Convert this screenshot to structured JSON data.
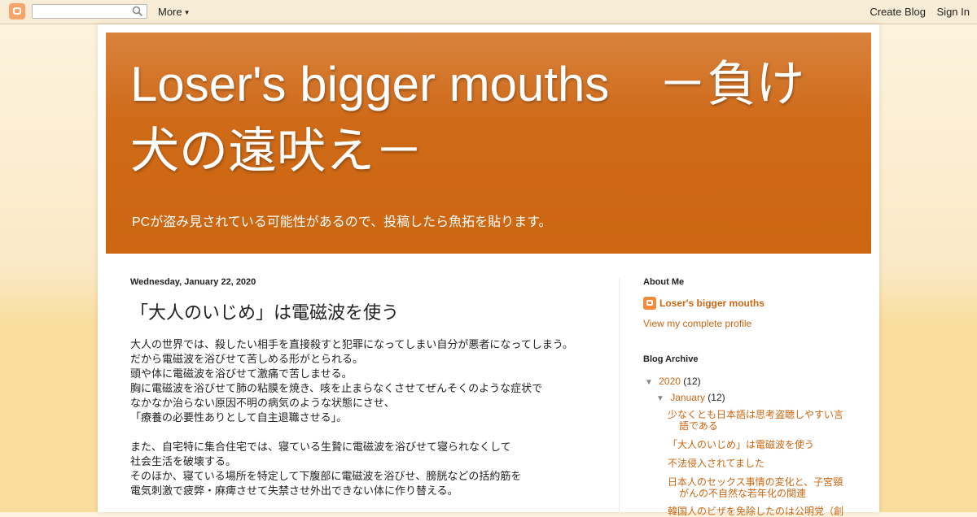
{
  "navbar": {
    "search_placeholder": "",
    "more_label": "More",
    "create_blog_label": "Create Blog",
    "sign_in_label": "Sign In"
  },
  "header": {
    "title_line1": "Loser's bigger mouths　－負け",
    "title_line2": "犬の遠吠え－",
    "description": "PCが盗み見されている可能性があるので、投稿したら魚拓を貼ります。"
  },
  "post": {
    "date": "Wednesday, January 22, 2020",
    "title": "「大人のいじめ」は電磁波を使う",
    "paragraph1": [
      "大人の世界では、殺したい相手を直接殺すと犯罪になってしまい自分が悪者になってしまう。",
      "だから電磁波を浴びせて苦しめる形がとられる。",
      "頭や体に電磁波を浴びせて激痛で苦しませる。",
      "胸に電磁波を浴びせて肺の粘膜を焼き、咳を止まらなくさせてぜんそくのような症状で",
      "なかなか治らない原因不明の病気のような状態にさせ、",
      "「療養の必要性ありとして自主退職させる」。"
    ],
    "paragraph2": [
      "また、自宅特に集合住宅では、寝ている生贄に電磁波を浴びせて寝られなくして",
      "社会生活を破壊する。",
      "そのほか、寝ている場所を特定して下腹部に電磁波を浴びせ、膀胱などの括約筋を",
      "電気刺激で疲弊・麻痺させて失禁させ外出できない体に作り替える。"
    ]
  },
  "sidebar": {
    "about_heading": "About Me",
    "profile_name": "Loser's bigger mouths",
    "profile_link": "View my complete profile",
    "archive_heading": "Blog Archive",
    "year": {
      "toggle": "▼",
      "label": "2020",
      "count": "(12)"
    },
    "month": {
      "toggle": "▼",
      "label": "January",
      "count": "(12)"
    },
    "posts": [
      {
        "line1": "少なくとも日本語は思考盗聴しやすい言",
        "line2": "語である"
      },
      {
        "line1": "「大人のいじめ」は電磁波を使う",
        "line2": ""
      },
      {
        "line1": "不法侵入されてました",
        "line2": ""
      },
      {
        "line1": "日本人のセックス事情の変化と、子宮頸",
        "line2": "がんの不自然な若年化の関連"
      },
      {
        "line1": "韓国人のビザを免除したのは公明党（創",
        "line2": ""
      }
    ]
  },
  "colors": {
    "accent": "#cc6611",
    "header_bg": "#cc6611",
    "page_bg": "#f8dd9d"
  }
}
